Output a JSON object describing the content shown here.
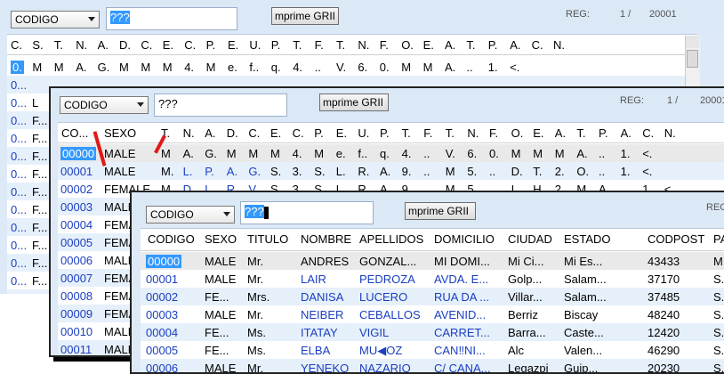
{
  "win1": {
    "combo": "CODIGO",
    "search": "???",
    "print_btn": "mprime GRII",
    "reg_label": "REG:",
    "reg_pos": "1 /",
    "reg_total": "20001",
    "headers": [
      "C.",
      "S.",
      "T.",
      "N.",
      "A.",
      "D.",
      "C.",
      "E.",
      "C.",
      "P.",
      "E.",
      "U.",
      "P.",
      "T.",
      "F.",
      "T.",
      "N.",
      "F.",
      "O.",
      "E.",
      "A.",
      "T.",
      "P.",
      "A.",
      "C.",
      "N."
    ],
    "row0": [
      "0.",
      "M",
      "M",
      "A.",
      "G.",
      "M",
      "M",
      "M",
      "4.",
      "M",
      "e.",
      "f..",
      "q.",
      "4.",
      "..",
      "V.",
      "6.",
      "0.",
      "M",
      "M",
      "A.",
      "..",
      "1.",
      "<."
    ],
    "codes": [
      "0...",
      "0...",
      "0...",
      "0...",
      "0...",
      "0...",
      "0...",
      "0...",
      "0...",
      "0...",
      "0...",
      "0...",
      "0..."
    ],
    "letters": [
      "",
      "L",
      "F...",
      "F...",
      "F...",
      "F...",
      "F...",
      "F...",
      "F...",
      "F...",
      "F...",
      "F...",
      "F..."
    ]
  },
  "win2": {
    "combo": "CODIGO",
    "search": "???",
    "print_btn": "mprime GRII",
    "reg_label": "REG:",
    "reg_pos": "1 /",
    "reg_total": "20001",
    "headers": [
      "CO...",
      "SEXO",
      "T.",
      "N.",
      "A.",
      "D.",
      "C.",
      "E.",
      "C.",
      "P.",
      "E.",
      "U.",
      "P.",
      "T.",
      "F.",
      "T.",
      "N.",
      "F.",
      "O.",
      "E.",
      "A.",
      "T.",
      "P.",
      "A.",
      "C.",
      "N."
    ],
    "rows": [
      {
        "code": "00000",
        "sexo": "MALE",
        "rest": [
          "M",
          "A.",
          "G.",
          "M",
          "M",
          "M",
          "4.",
          "M",
          "e.",
          "f..",
          "q.",
          "4.",
          "..",
          "V.",
          "6.",
          "0.",
          "M",
          "M",
          "M",
          "A.",
          "..",
          "1.",
          "<."
        ]
      },
      {
        "code": "00001",
        "sexo": "MALE",
        "rest": [
          "M.",
          "L.",
          "P.",
          "A.",
          "G.",
          "S.",
          "3.",
          "S.",
          "L.",
          "R.",
          "A.",
          "9.",
          "..",
          "M",
          "5.",
          "..",
          "D.",
          "T.",
          "2.",
          "O.",
          "..",
          "1.",
          "<."
        ]
      },
      {
        "code": "00002",
        "sexo": "FEMALE",
        "rest": [
          "M",
          "D.",
          "L.",
          "R.",
          "V.",
          "S.",
          "3.",
          "S.",
          "L.",
          "R.",
          "A.",
          "9.",
          "..",
          "M",
          "5.",
          "..",
          "I.",
          "H.",
          "2.",
          "M",
          "A.",
          "..",
          "1.",
          "<."
        ]
      },
      {
        "code": "00003",
        "sexo": "MALE"
      },
      {
        "code": "00004",
        "sexo": "FEMA"
      },
      {
        "code": "00005",
        "sexo": "FEMA"
      },
      {
        "code": "00006",
        "sexo": "MALE"
      },
      {
        "code": "00007",
        "sexo": "FEMA"
      },
      {
        "code": "00008",
        "sexo": "FEMA"
      },
      {
        "code": "00009",
        "sexo": "FEMA"
      },
      {
        "code": "00010",
        "sexo": "MALE"
      },
      {
        "code": "00011",
        "sexo": "MALE"
      }
    ]
  },
  "win3": {
    "combo": "CODIGO",
    "search": "???",
    "print_btn": "mprime GRII",
    "reg_label": "REG",
    "headers": [
      "CODIGO",
      "SEXO",
      "TITULO",
      "NOMBRE",
      "APELLIDOS",
      "DOMICILIO",
      "CIUDAD",
      "ESTADO",
      "CODPOST",
      "PAIS"
    ],
    "rows": [
      [
        "00000",
        "MALE",
        "Mr.",
        "ANDRES",
        "GONZAL...",
        "MI DOMI...",
        "Mi Ci...",
        "Mi Es...",
        "43433",
        "M..."
      ],
      [
        "00001",
        "MALE",
        "Mr.",
        "LAIR",
        "PEDROZA",
        "AVDA. E...",
        "Golp...",
        "Salam...",
        "37170",
        "S..."
      ],
      [
        "00002",
        "FE...",
        "Mrs.",
        "DANISA",
        "LUCERO",
        "RUA DA ...",
        "Villar...",
        "Salam...",
        "37485",
        "S..."
      ],
      [
        "00003",
        "MALE",
        "Mr.",
        "NEIBER",
        "CEBALLOS",
        "AVENID...",
        "Berriz",
        "Biscay",
        "48240",
        "S..."
      ],
      [
        "00004",
        "FE...",
        "Ms.",
        "ITATAY",
        "VIGIL",
        "CARRET...",
        "Barra...",
        "Caste...",
        "12420",
        "S..."
      ],
      [
        "00005",
        "FE...",
        "Ms.",
        "ELBA",
        "MU◀OZ",
        "CAN‼NI...",
        "Alc",
        "Valen...",
        "46290",
        "S..."
      ],
      [
        "00006",
        "MALE",
        "Mr.",
        "YENEKO",
        "NAZARIO",
        "C/ CANA...",
        "Legazpi",
        "Guip...",
        "20230",
        "S..."
      ]
    ]
  }
}
